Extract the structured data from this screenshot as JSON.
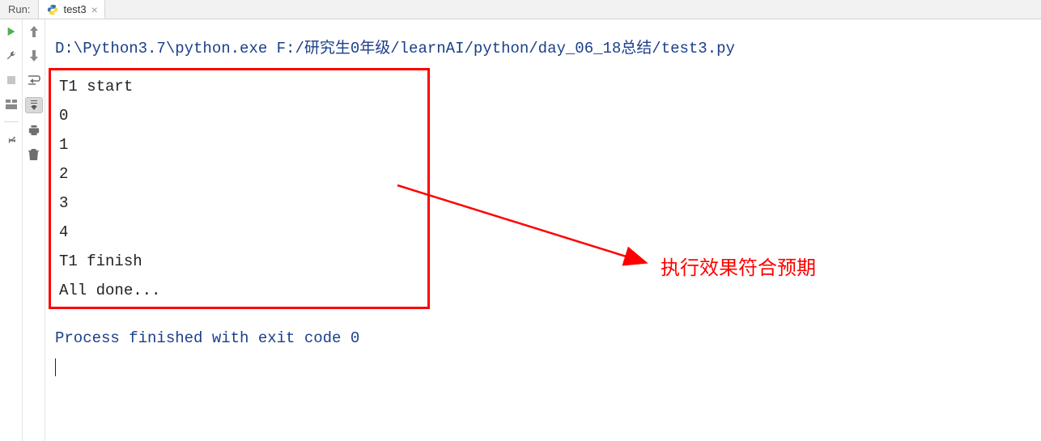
{
  "header": {
    "run_label": "Run:",
    "tab": {
      "label": "test3"
    }
  },
  "console": {
    "command": "D:\\Python3.7\\python.exe F:/研究生0年级/learnAI/python/day_06_18总结/test3.py",
    "output": {
      "l0": "T1 start",
      "l1": "0",
      "l2": "1",
      "l3": "2",
      "l4": "3",
      "l5": "4",
      "l6": "T1 finish",
      "l7": "All done..."
    },
    "process": "Process finished with exit code 0"
  },
  "annotation": {
    "text": "执行效果符合预期"
  },
  "icons": {
    "left": [
      "play",
      "wrench",
      "stop",
      "layout",
      "pin"
    ],
    "second": [
      "up",
      "down",
      "wrap",
      "scroll-end",
      "print",
      "trash"
    ]
  }
}
